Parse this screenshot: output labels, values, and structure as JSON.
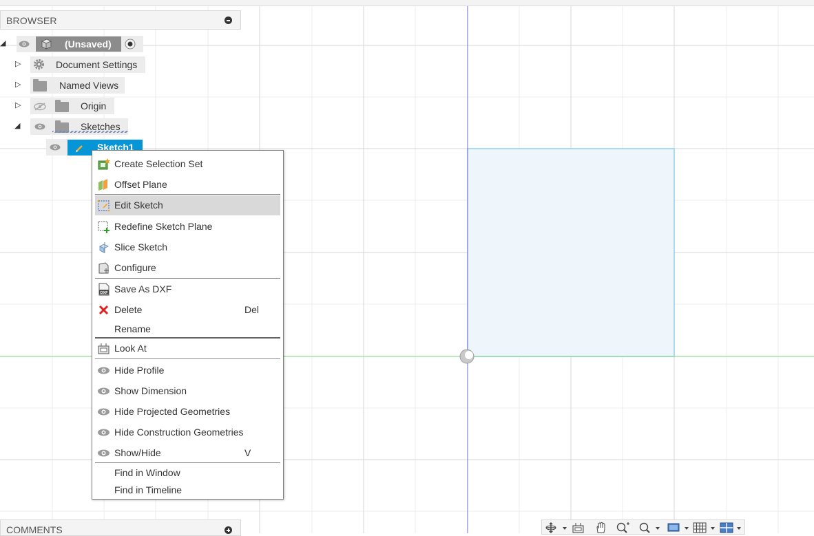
{
  "browser": {
    "title": "BROWSER",
    "root": {
      "label": "(Unsaved)"
    },
    "items": [
      {
        "label": "Document Settings",
        "icon": "gear-icon"
      },
      {
        "label": "Named Views",
        "icon": "folder-icon"
      },
      {
        "label": "Origin",
        "icon": "folder-icon"
      },
      {
        "label": "Sketches",
        "icon": "folder-icon"
      },
      {
        "label": "Sketch1",
        "icon": "sketch-icon",
        "selected": true
      }
    ]
  },
  "context_menu": {
    "items": [
      {
        "label": "Create Selection Set",
        "icon": "selection-set-icon"
      },
      {
        "label": "Offset Plane",
        "icon": "offset-plane-icon"
      },
      {
        "label": "Edit Sketch",
        "icon": "edit-sketch-icon",
        "highlighted": true
      },
      {
        "label": "Redefine Sketch Plane",
        "icon": "redefine-plane-icon"
      },
      {
        "label": "Slice Sketch",
        "icon": "slice-icon"
      },
      {
        "label": "Configure",
        "icon": "configure-icon"
      },
      {
        "label": "Save As DXF",
        "icon": "dxf-icon"
      },
      {
        "label": "Delete",
        "icon": "delete-icon",
        "shortcut": "Del"
      },
      {
        "label": "Rename"
      },
      {
        "label": "Look At",
        "icon": "look-at-icon"
      },
      {
        "label": "Hide Profile",
        "icon": "eye-icon"
      },
      {
        "label": "Show Dimension",
        "icon": "eye-icon"
      },
      {
        "label": "Hide Projected Geometries",
        "icon": "eye-icon"
      },
      {
        "label": "Hide Construction Geometries",
        "icon": "eye-icon"
      },
      {
        "label": "Show/Hide",
        "icon": "eye-icon",
        "shortcut": "V"
      },
      {
        "label": "Find in Window"
      },
      {
        "label": "Find in Timeline"
      }
    ]
  },
  "comments": {
    "title": "COMMENTS"
  },
  "navbar": {
    "icons": [
      "orbit-icon",
      "look-at-icon",
      "pan-icon",
      "zoom-icon",
      "zoom-window-icon",
      "display-mode-icon",
      "grid-icon",
      "viewports-icon"
    ]
  },
  "colors": {
    "selection_blue": "#0696d7",
    "sketch_fill": "#eef6fb",
    "sketch_edge": "#8fd0ee",
    "axis_x": "#7ad67a",
    "axis_y": "#6b6bd8",
    "menu_highlight": "#d9d9d9"
  }
}
